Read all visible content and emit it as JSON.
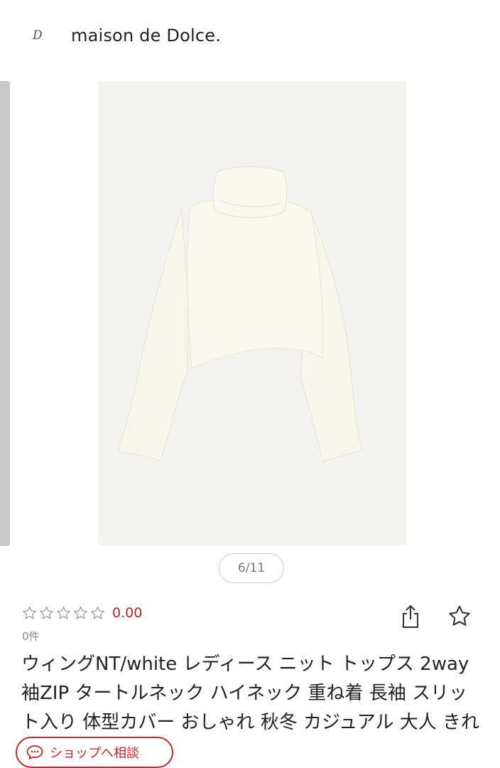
{
  "header": {
    "logo_mark": "D",
    "brand_name": "maison de Dolce."
  },
  "gallery": {
    "pager_text": "6/11",
    "image_alt": "white turtleneck cropped knit top"
  },
  "rating": {
    "stars_filled": 0,
    "stars_total": 5,
    "value": "0.00",
    "review_count": "0件"
  },
  "actions": {
    "share_icon": "share-icon",
    "favorite_icon": "star-outline-icon"
  },
  "product": {
    "title": "ウィングNT/white レディース ニット トップス 2way 袖ZIP タートルネック ハイネック 重ね着 長袖 スリット入り 体型カバー おしゃれ 秋冬 カジュアル 大人 きれいめ 手洗い可"
  },
  "consult": {
    "label": "ショップへ相談",
    "icon": "chat-bubble-icon"
  },
  "colors": {
    "accent_red": "#c62828",
    "rating_red": "#b3261e"
  }
}
